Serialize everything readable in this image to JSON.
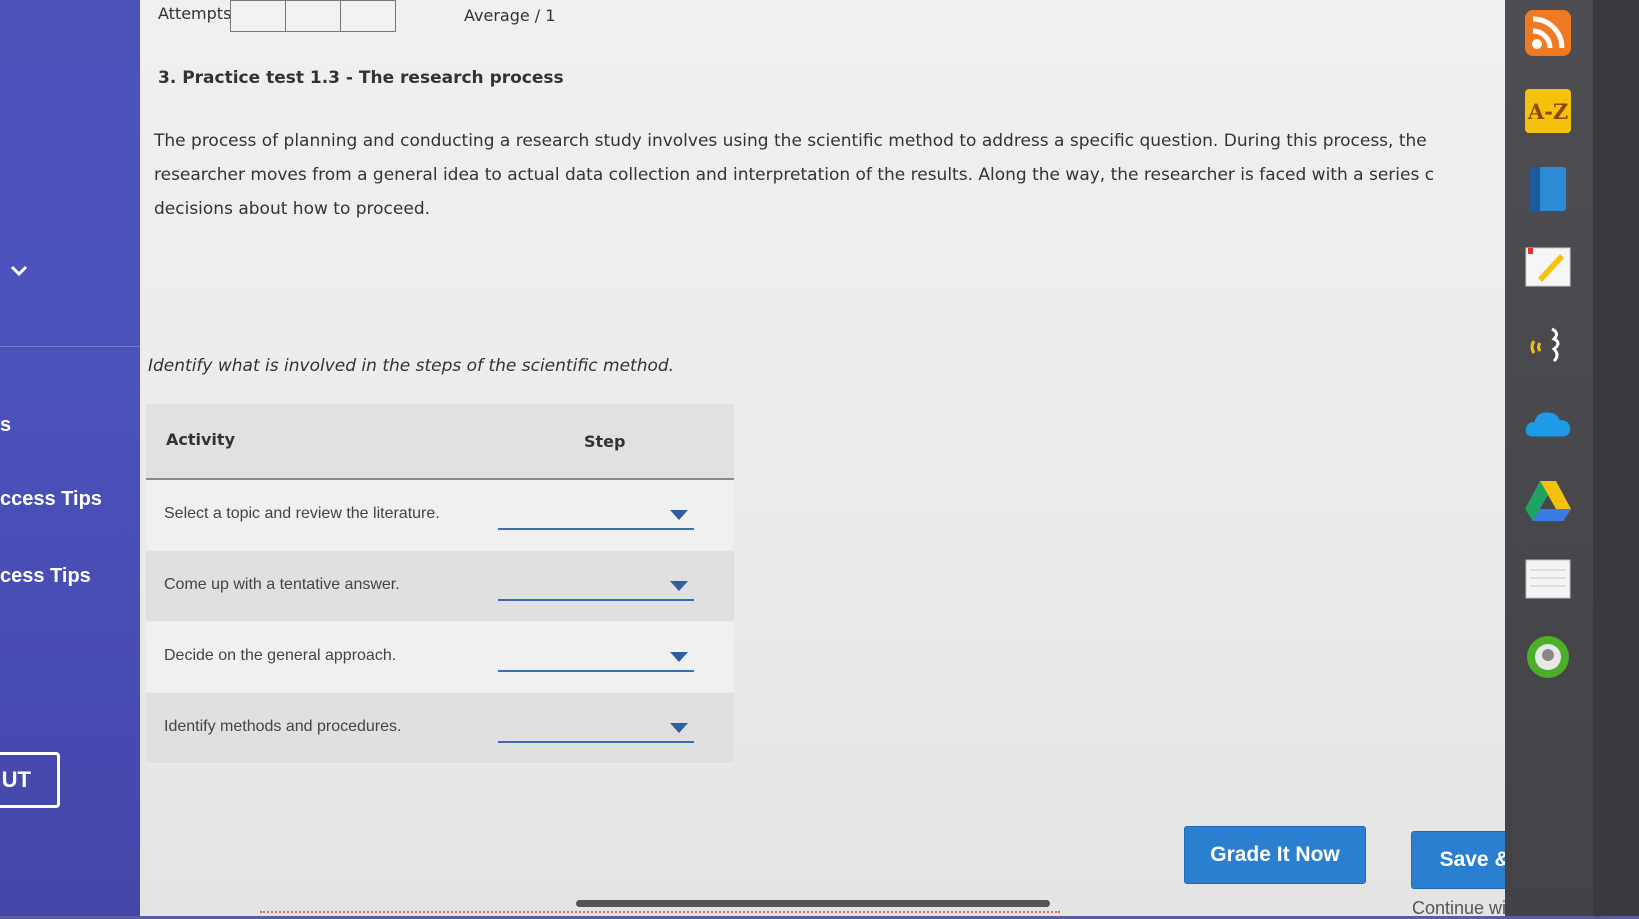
{
  "sidebar": {
    "fragment_text": "s",
    "items": [
      {
        "label": "ccess Tips"
      },
      {
        "label": "cess Tips"
      }
    ],
    "out_label": "UT"
  },
  "header": {
    "attempts_label": "Attempts",
    "average_label": "Average / 1"
  },
  "question": {
    "title": "3. Practice test 1.3 - The research process",
    "intro": "The process of planning and conducting a research study involves using the scientific method to address a specific question. During this process, the researcher moves from a general idea to actual data collection and interpretation of the results. Along the way, the researcher is faced with a series c decisions about how to proceed.",
    "instruction": "Identify what is involved in the steps of the scientific method."
  },
  "table": {
    "headers": {
      "activity": "Activity",
      "step": "Step"
    },
    "rows": [
      {
        "activity": "Select a topic and review the literature.",
        "step": ""
      },
      {
        "activity": "Come up with a tentative answer.",
        "step": ""
      },
      {
        "activity": "Decide on the general approach.",
        "step": ""
      },
      {
        "activity": "Identify methods and procedures.",
        "step": ""
      }
    ]
  },
  "actions": {
    "grade_label": "Grade It Now",
    "save_label": "Save & Continue",
    "continue_label": "Continue without saving"
  },
  "toolbar": {
    "icons": [
      "rss-icon",
      "a-z-icon",
      "book-icon",
      "notepad-icon",
      "speech-icon",
      "onedrive-icon",
      "google-drive-icon",
      "notes-icon",
      "circle-icon"
    ],
    "az_label": "A-Z"
  },
  "colors": {
    "sidebar": "#4a52bc",
    "button": "#2a7fd1",
    "dropdown_line": "#3b6db0"
  }
}
